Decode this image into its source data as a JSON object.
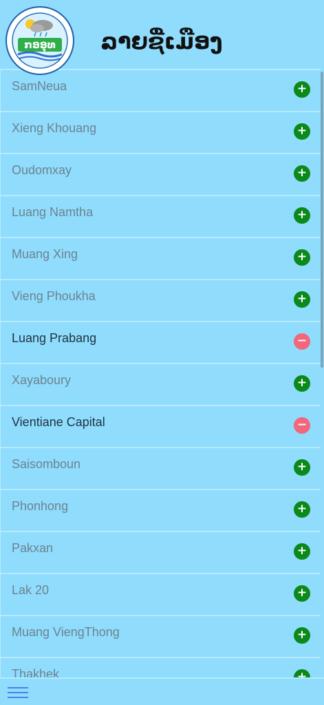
{
  "header": {
    "logo_icon": "meteorology-department-logo",
    "title": "ລາຍຊື່ເມືອງ"
  },
  "list": {
    "items": [
      {
        "label": "SamNeua",
        "action": "add"
      },
      {
        "label": "Xieng Khouang",
        "action": "add"
      },
      {
        "label": "Oudomxay",
        "action": "add"
      },
      {
        "label": "Luang Namtha",
        "action": "add"
      },
      {
        "label": "Muang Xing",
        "action": "add"
      },
      {
        "label": "Vieng Phoukha",
        "action": "add"
      },
      {
        "label": "Luang Prabang",
        "action": "remove"
      },
      {
        "label": "Xayaboury",
        "action": "add"
      },
      {
        "label": "Vientiane Capital",
        "action": "remove"
      },
      {
        "label": "Saisomboun",
        "action": "add"
      },
      {
        "label": "Phonhong",
        "action": "add"
      },
      {
        "label": "Pakxan",
        "action": "add"
      },
      {
        "label": "Lak 20",
        "action": "add"
      },
      {
        "label": "Muang ViengThong",
        "action": "add"
      },
      {
        "label": "Thakhek",
        "action": "add"
      }
    ],
    "add_symbol": "+",
    "remove_symbol": "−"
  },
  "footer": {
    "menu_icon": "hamburger-menu-icon"
  },
  "colors": {
    "background": "#8fdcfd",
    "add": "#0b8a1b",
    "remove": "#f2677c",
    "menu": "#4a80f0"
  }
}
